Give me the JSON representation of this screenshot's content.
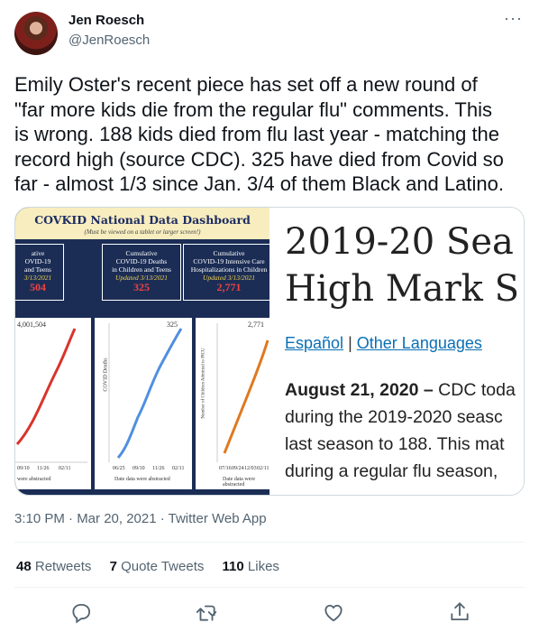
{
  "user": {
    "name": "Jen Roesch",
    "handle": "@JenRoesch"
  },
  "tweet": {
    "lines": [
      "Emily Oster's recent piece has set off a new round of",
      "\"far more kids die from the regular flu\" comments. This",
      "is wrong. 188 kids died from flu last year - matching the",
      "record high (source CDC). 325 have died from Covid so",
      "far - almost 1/3 since Jan. 3/4 of them Black and Latino."
    ]
  },
  "image_left": {
    "title": "COVKID National Data Dashboard",
    "subtitle": "(Must be viewed on a tablet or larger screen!)",
    "cards": [
      {
        "line1": "ative",
        "line2": "OVID-19",
        "line3": "and Teens",
        "updated": "3/13/2021",
        "value": "504"
      },
      {
        "line1": "Cumulative",
        "line2": "COVID-19 Deaths",
        "line3": "in Children and Teens",
        "updated": "Updated 3/13/2021",
        "value": "325"
      },
      {
        "line1": "Cumulative",
        "line2": "COVID-19 Intensive Care",
        "line3": "Hospitalizations in Children",
        "updated": "Updated 3/13/2021",
        "value": "2,771"
      }
    ],
    "panel_labels": [
      "4,001,504",
      "325",
      "2,771"
    ],
    "y_axis_label": "COVID Deaths",
    "y_axis_label_3": "Number of Children Admitted to PICU",
    "x_ticks_1": [
      "09/10",
      "11/26",
      "02/11"
    ],
    "x_ticks_2": [
      "06/25",
      "09/10",
      "11/26",
      "02/11"
    ],
    "x_ticks_3": [
      "07/16",
      "09/24",
      "12/03",
      "02/11"
    ],
    "captions": [
      "were abstracted",
      "Date data were abstracted",
      "Date data were abstracted"
    ],
    "colors": {
      "panel1": "#d9342b",
      "panel2": "#4f8fe0",
      "panel3": "#e0781f",
      "value": "#f04343"
    }
  },
  "image_right": {
    "headline_line1": "2019-20 Sea",
    "headline_line2": "High Mark S",
    "link1": "Español",
    "separator": "|",
    "link2": "Other Languages",
    "date": "August 21, 2020 –",
    "body_line1_rest": " CDC toda",
    "body_line2": "during the 2019-2020 seasc",
    "body_line3": "last season to 188. This mat",
    "body_line4": "during a regular flu season,"
  },
  "meta": {
    "time": "3:10 PM · Mar 20, 2021 · Twitter Web App"
  },
  "stats": {
    "retweets_count": "48",
    "retweets_label": "Retweets",
    "quotes_count": "7",
    "quotes_label": "Quote Tweets",
    "likes_count": "110",
    "likes_label": "Likes"
  },
  "icons": [
    "more-icon",
    "reply-icon",
    "retweet-icon",
    "like-icon",
    "share-icon"
  ],
  "colors": {
    "text": "#0f1419",
    "secondary": "#536471",
    "border": "#cfd9de"
  }
}
